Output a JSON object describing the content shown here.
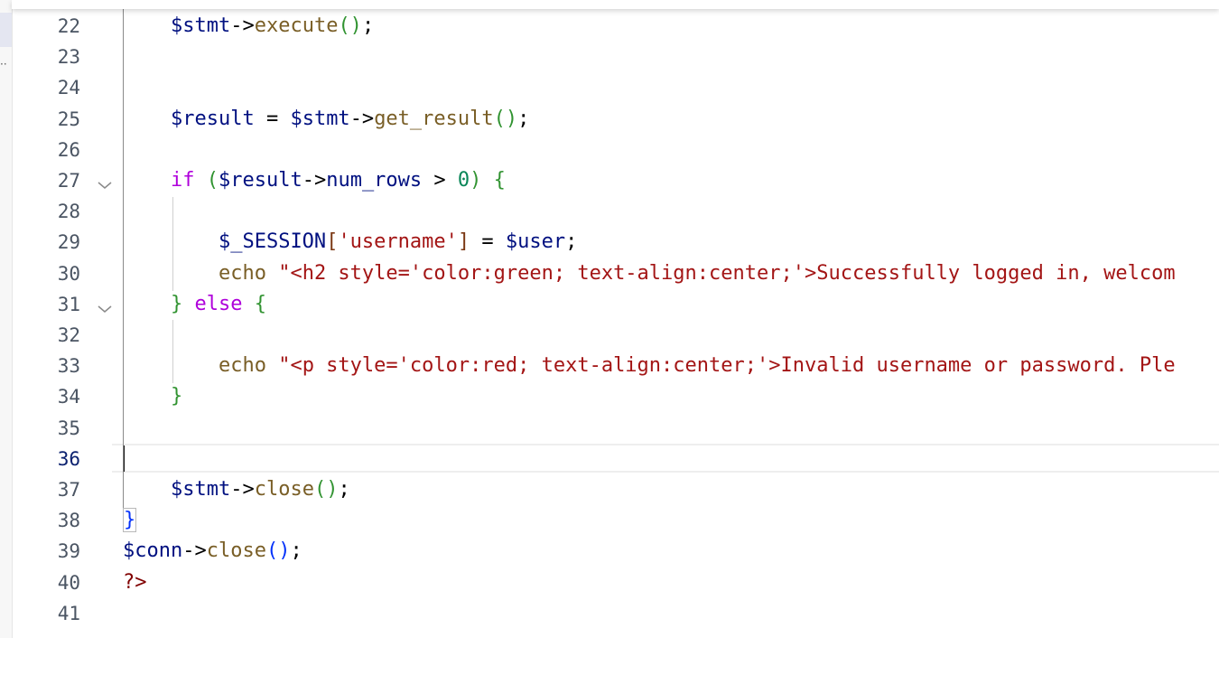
{
  "editor": {
    "current_line": 36,
    "lines": [
      {
        "number": 22,
        "fold": false,
        "tokens": [
          {
            "t": "    ",
            "c": "d"
          },
          {
            "t": "$stmt",
            "c": "v"
          },
          {
            "t": "->",
            "c": "p"
          },
          {
            "t": "execute",
            "c": "f"
          },
          {
            "t": "()",
            "c": "b2"
          },
          {
            "t": ";",
            "c": "p"
          }
        ]
      },
      {
        "number": 23,
        "fold": false,
        "tokens": []
      },
      {
        "number": 24,
        "fold": false,
        "tokens": []
      },
      {
        "number": 25,
        "fold": false,
        "tokens": [
          {
            "t": "    ",
            "c": "d"
          },
          {
            "t": "$result",
            "c": "v"
          },
          {
            "t": " = ",
            "c": "p"
          },
          {
            "t": "$stmt",
            "c": "v"
          },
          {
            "t": "->",
            "c": "p"
          },
          {
            "t": "get_result",
            "c": "f"
          },
          {
            "t": "()",
            "c": "b2"
          },
          {
            "t": ";",
            "c": "p"
          }
        ]
      },
      {
        "number": 26,
        "fold": false,
        "tokens": []
      },
      {
        "number": 27,
        "fold": true,
        "tokens": [
          {
            "t": "    ",
            "c": "d"
          },
          {
            "t": "if",
            "c": "k"
          },
          {
            "t": " ",
            "c": "d"
          },
          {
            "t": "(",
            "c": "b2"
          },
          {
            "t": "$result",
            "c": "v"
          },
          {
            "t": "->",
            "c": "p"
          },
          {
            "t": "num_rows",
            "c": "v"
          },
          {
            "t": " > ",
            "c": "p"
          },
          {
            "t": "0",
            "c": "n"
          },
          {
            "t": ")",
            "c": "b2"
          },
          {
            "t": " ",
            "c": "d"
          },
          {
            "t": "{",
            "c": "b2"
          }
        ]
      },
      {
        "number": 28,
        "fold": false,
        "tokens": []
      },
      {
        "number": 29,
        "fold": false,
        "tokens": [
          {
            "t": "        ",
            "c": "d"
          },
          {
            "t": "$_SESSION",
            "c": "v"
          },
          {
            "t": "[",
            "c": "b3"
          },
          {
            "t": "'username'",
            "c": "s"
          },
          {
            "t": "]",
            "c": "b3"
          },
          {
            "t": " = ",
            "c": "p"
          },
          {
            "t": "$user",
            "c": "v"
          },
          {
            "t": ";",
            "c": "p"
          }
        ]
      },
      {
        "number": 30,
        "fold": false,
        "tokens": [
          {
            "t": "        ",
            "c": "d"
          },
          {
            "t": "echo",
            "c": "f"
          },
          {
            "t": " ",
            "c": "d"
          },
          {
            "t": "\"<h2 style='color:green; text-align:center;'>Successfully logged in, welcom",
            "c": "s"
          }
        ]
      },
      {
        "number": 31,
        "fold": true,
        "tokens": [
          {
            "t": "    ",
            "c": "d"
          },
          {
            "t": "}",
            "c": "b2"
          },
          {
            "t": " ",
            "c": "d"
          },
          {
            "t": "else",
            "c": "k"
          },
          {
            "t": " ",
            "c": "d"
          },
          {
            "t": "{",
            "c": "b2"
          }
        ]
      },
      {
        "number": 32,
        "fold": false,
        "tokens": []
      },
      {
        "number": 33,
        "fold": false,
        "tokens": [
          {
            "t": "        ",
            "c": "d"
          },
          {
            "t": "echo",
            "c": "f"
          },
          {
            "t": " ",
            "c": "d"
          },
          {
            "t": "\"<p style='color:red; text-align:center;'>Invalid username or password. Ple",
            "c": "s"
          }
        ]
      },
      {
        "number": 34,
        "fold": false,
        "tokens": [
          {
            "t": "    ",
            "c": "d"
          },
          {
            "t": "}",
            "c": "b2"
          }
        ]
      },
      {
        "number": 35,
        "fold": false,
        "tokens": []
      },
      {
        "number": 36,
        "fold": false,
        "tokens": []
      },
      {
        "number": 37,
        "fold": false,
        "tokens": [
          {
            "t": "    ",
            "c": "d"
          },
          {
            "t": "$stmt",
            "c": "v"
          },
          {
            "t": "->",
            "c": "p"
          },
          {
            "t": "close",
            "c": "f"
          },
          {
            "t": "()",
            "c": "b2"
          },
          {
            "t": ";",
            "c": "p"
          }
        ]
      },
      {
        "number": 38,
        "fold": false,
        "tokens": [
          {
            "t": "}",
            "c": "b1"
          }
        ]
      },
      {
        "number": 39,
        "fold": false,
        "tokens": [
          {
            "t": "$conn",
            "c": "v"
          },
          {
            "t": "->",
            "c": "p"
          },
          {
            "t": "close",
            "c": "f"
          },
          {
            "t": "()",
            "c": "b1"
          },
          {
            "t": ";",
            "c": "p"
          }
        ]
      },
      {
        "number": 40,
        "fold": false,
        "tokens": [
          {
            "t": "?>",
            "c": "t"
          }
        ]
      },
      {
        "number": 41,
        "fold": false,
        "tokens": []
      }
    ]
  },
  "icons": {
    "fold": "chevron-down-icon"
  }
}
